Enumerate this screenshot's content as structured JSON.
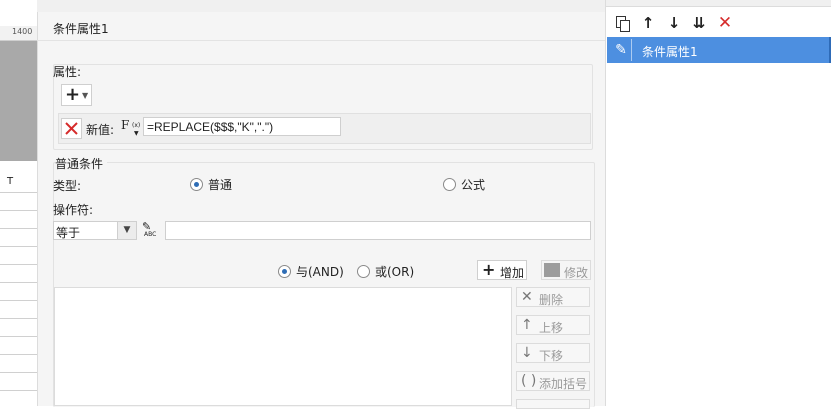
{
  "background": {
    "ruler_label": "1400",
    "column_label": "T"
  },
  "dialog": {
    "title": "条件属性1",
    "property_group": {
      "label": "属性:",
      "add_icon": "plus-icon",
      "new_value_label": "新值:",
      "formula_icon": "fx-icon",
      "formula_value": "=REPLACE($$$,\"K\",\".\")"
    },
    "condition_group": {
      "label": "普通条件",
      "type_label": "类型:",
      "type_options": [
        {
          "label": "普通",
          "selected": true
        },
        {
          "label": "公式",
          "selected": false
        }
      ],
      "operator_label": "操作符:",
      "operator_value": "等于",
      "operand_value": "",
      "logic_options": [
        {
          "label": "与(AND)",
          "selected": true
        },
        {
          "label": "或(OR)",
          "selected": false
        }
      ],
      "buttons": {
        "add": "增加",
        "modify": "修改",
        "delete": "删除",
        "move_up": "上移",
        "move_down": "下移",
        "add_bracket": "添加括号"
      }
    }
  },
  "right_panel": {
    "toolbar": [
      "copy-icon",
      "move-up-icon",
      "move-down-icon",
      "move-to-bottom-icon",
      "delete-icon"
    ],
    "items": [
      {
        "label": "条件属性1",
        "selected": true
      }
    ]
  },
  "colors": {
    "selection": "#4d8fe0",
    "delete_red": "#d62b2b",
    "radio_dot": "#2f6db5"
  }
}
